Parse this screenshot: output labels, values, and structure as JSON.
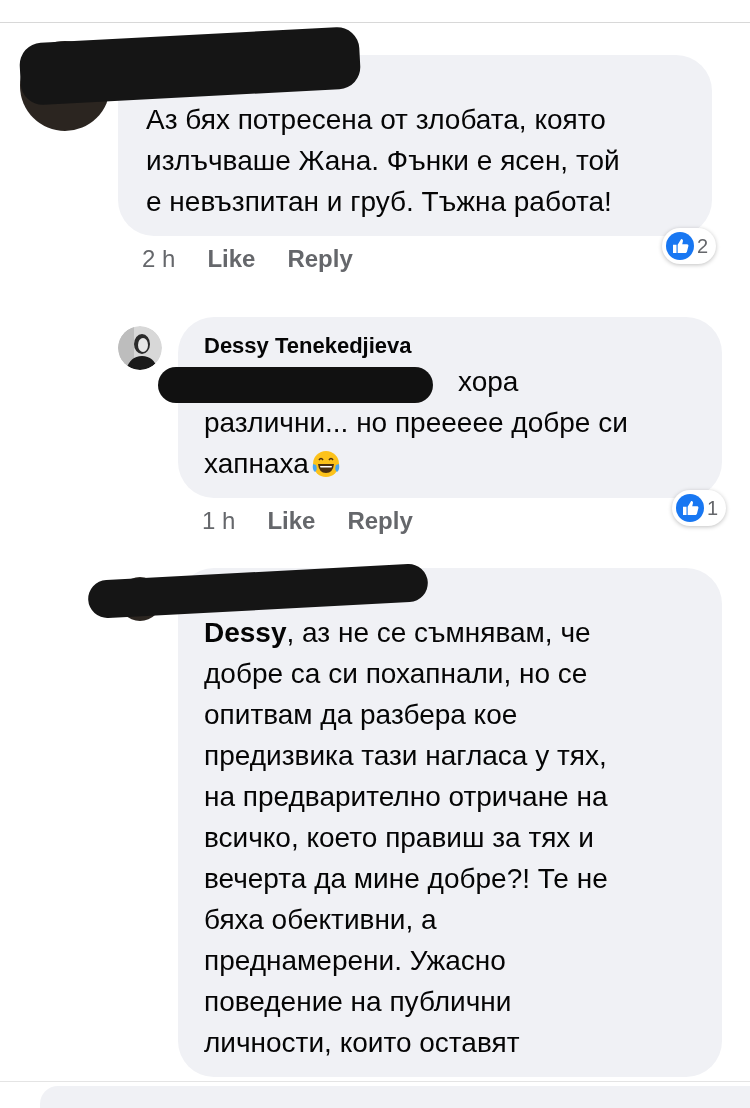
{
  "comments": [
    {
      "kind": "comment",
      "name_redacted": true,
      "lines": [
        {
          "text": "Аз бях потресена от злобата, която"
        },
        {
          "text": "излъчваше Жана. Фънки е ясен, той"
        },
        {
          "text": "е невъзпитан и груб. Тъжна работа!"
        }
      ],
      "time": "2 h",
      "actions": [
        "Like",
        "Reply"
      ],
      "reactions": "2"
    },
    {
      "kind": "reply",
      "name": "Dessy Tenekedjieva",
      "lines": [
        {
          "text": "хора",
          "mention_redacted": true
        },
        {
          "text": "различни... но преееее добре си"
        },
        {
          "text": "хапнаха",
          "emoji": true
        }
      ],
      "time": "1 h",
      "actions": [
        "Like",
        "Reply"
      ],
      "reactions": "1"
    },
    {
      "kind": "reply",
      "name_redacted": true,
      "lines": [
        {
          "text": "**Dessy**, аз не се съмнявам, че"
        },
        {
          "text": "добре са си похапнали, но се"
        },
        {
          "text": "опитвам да разбера кое"
        },
        {
          "text": "предизвика тази нагласа у тях,"
        },
        {
          "text": "на предварително отричане на"
        },
        {
          "text": "всичко, което правиш за тях и"
        },
        {
          "text": "вечерта да мине добре?! Те не"
        },
        {
          "text": "бяха обективни, а"
        },
        {
          "text": "преднамерени. Ужасно"
        },
        {
          "text": "поведение на публични"
        },
        {
          "text": "личности, които оставят"
        }
      ]
    }
  ]
}
